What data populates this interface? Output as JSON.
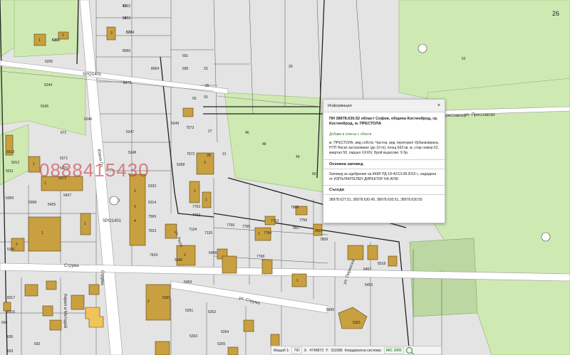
{
  "map": {
    "corner_number": "26",
    "watermark": "0888415430",
    "parcel_labels": [
      "5202",
      "5203",
      "5204",
      "5206",
      "5205",
      "8066",
      "5244",
      "8064",
      "8479",
      "5245",
      "5246",
      "5247",
      "5248",
      "5249",
      "5268",
      "7573",
      "671",
      "5013",
      "5012",
      "5011",
      "5009",
      "5271",
      "5273",
      "5272",
      "5425",
      "5008",
      "5427",
      "5347",
      "5314",
      "5333",
      "7569",
      "7623",
      "7624",
      "5340",
      "5458",
      "7572",
      "7763",
      "7763",
      "7135",
      "7134",
      "7766",
      "7765",
      "7764",
      "7768",
      "7808",
      "7809",
      "7806",
      "7807",
      "7763",
      "7756",
      "5459",
      "5456",
      "5260",
      "5261",
      "5262",
      "5263",
      "5264",
      "5265",
      "5301",
      "5453",
      "5457",
      "8318",
      "8317",
      "8316",
      "694",
      "695",
      "693",
      "692",
      "691",
      "690",
      "23",
      "25",
      "29",
      "27",
      "28",
      "21",
      "46",
      "48",
      "49",
      "51",
      "52",
      "53",
      "55",
      "56",
      "47",
      "45",
      "43",
      "54",
      "627",
      "630"
    ],
    "building_labels": [
      "1",
      "2",
      "3",
      "1",
      "2",
      "1",
      "1",
      "2",
      "3",
      "4",
      "1",
      "1",
      "1",
      "2",
      "3",
      "1",
      "1",
      "2"
    ],
    "road_labels": [
      "SPO1401",
      "SPO1401",
      "Струма",
      "ул. Струма",
      "Струма",
      "Южна Гр.",
      "800",
      "ул. Рила",
      "ул. Пиринска",
      "Кирил и Методий",
      "ул. Преславски",
      "к. Преславски"
    ]
  },
  "popup": {
    "header_title": "Информация",
    "close_symbol": "×",
    "title": "ПИ 38978.630.52 област София, община Костинброд, гр. Костинброд, м. ПРЕСТОЛА",
    "link": "Добави в списък с обекти",
    "description": "м. ПРЕСТОЛА, вид собств. Частна, вид територия Урбанизирана, НТП Ниско застрояване (до 10 m), площ 663 кв. м, стар номер 52, квартал 50, парцел XXXIV, Брой вързсове: 9 бр.",
    "section_order": "Основна заповед",
    "order_text": "Заповед за одобрение на КККР РД-18-42/13.08.2015 г., издадена от ИЗПЪЛНИТЕЛЕН ДИРЕКТОР НА АГКК",
    "section_neighbors": "Съседи",
    "neighbors_text": "38978.627.51, 38978.630.49, 38978.630.51, 38978.630.55"
  },
  "statusbar": {
    "scale_label": "Мащаб 1:",
    "scale_value": "780",
    "x_label": "X:",
    "x_value": "4745873",
    "y_label": "Y:",
    "y_value": "311586",
    "crs_label": "Координатна система:",
    "crs_value": "ККС 2005"
  },
  "colors": {
    "parcel_fill": "#e3e3e3",
    "green": "#c9e6a9",
    "building": "#c89a3a",
    "road": "#ffffff",
    "parcel_line": "#555555"
  }
}
